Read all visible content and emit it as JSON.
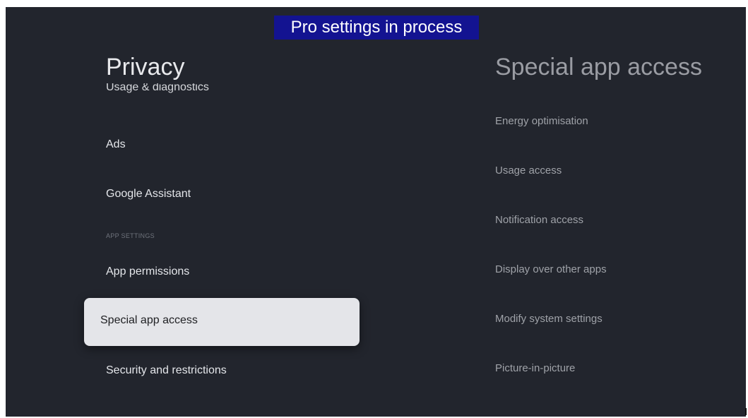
{
  "banner": {
    "text": "Pro settings in process"
  },
  "left_panel": {
    "title": "Privacy",
    "partial_item": "Usage & diagnostics",
    "items_top": [
      "Ads",
      "Google Assistant"
    ],
    "section_header": "APP SETTINGS",
    "items_bottom": [
      "App permissions"
    ],
    "selected_item": "Special app access",
    "items_after": [
      "Security and restrictions"
    ]
  },
  "right_panel": {
    "title": "Special app access",
    "items": [
      "Energy optimisation",
      "Usage access",
      "Notification access",
      "Display over other apps",
      "Modify system settings",
      "Picture-in-picture"
    ]
  },
  "colors": {
    "background": "#22252d",
    "banner": "#131391",
    "selected_bg": "#e4e5e9"
  }
}
